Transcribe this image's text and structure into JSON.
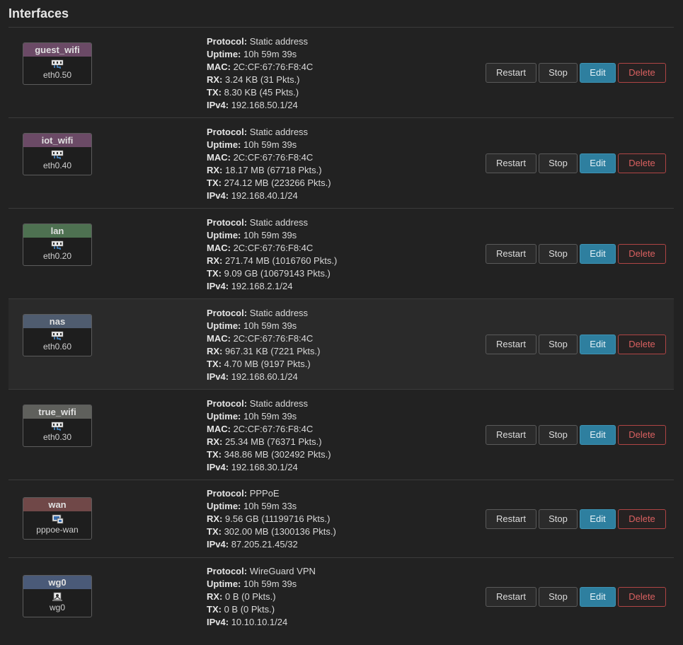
{
  "page": {
    "title": "Interfaces"
  },
  "labels": {
    "protocol": "Protocol:",
    "uptime": "Uptime:",
    "mac": "MAC:",
    "rx": "RX:",
    "tx": "TX:",
    "ipv4": "IPv4:"
  },
  "buttons": {
    "restart": "Restart",
    "stop": "Stop",
    "edit": "Edit",
    "delete": "Delete"
  },
  "colors": {
    "guest_wifi": "#6b4a66",
    "iot_wifi": "#6b4a66",
    "lan": "#4e7151",
    "nas": "#4f5c6f",
    "true_wifi": "#5f605c",
    "wan": "#704848",
    "wg0": "#4a5a78",
    "edit_button": "#2e7f9f",
    "delete_border": "#b04545"
  },
  "interfaces": [
    {
      "name": "guest_wifi",
      "device": "eth0.50",
      "icon": "ethernet-switch-icon",
      "protocol": "Static address",
      "uptime": "10h 59m 39s",
      "mac": "2C:CF:67:76:F8:4C",
      "rx": "3.24 KB (31 Pkts.)",
      "tx": "8.30 KB (45 Pkts.)",
      "ipv4": "192.168.50.1/24"
    },
    {
      "name": "iot_wifi",
      "device": "eth0.40",
      "icon": "ethernet-switch-icon",
      "protocol": "Static address",
      "uptime": "10h 59m 39s",
      "mac": "2C:CF:67:76:F8:4C",
      "rx": "18.17 MB (67718 Pkts.)",
      "tx": "274.12 MB (223266 Pkts.)",
      "ipv4": "192.168.40.1/24"
    },
    {
      "name": "lan",
      "device": "eth0.20",
      "icon": "ethernet-switch-icon",
      "protocol": "Static address",
      "uptime": "10h 59m 39s",
      "mac": "2C:CF:67:76:F8:4C",
      "rx": "271.74 MB (1016760 Pkts.)",
      "tx": "9.09 GB (10679143 Pkts.)",
      "ipv4": "192.168.2.1/24"
    },
    {
      "name": "nas",
      "device": "eth0.60",
      "icon": "ethernet-switch-icon",
      "protocol": "Static address",
      "uptime": "10h 59m 39s",
      "mac": "2C:CF:67:76:F8:4C",
      "rx": "967.31 KB (7221 Pkts.)",
      "tx": "4.70 MB (9197 Pkts.)",
      "ipv4": "192.168.60.1/24"
    },
    {
      "name": "true_wifi",
      "device": "eth0.30",
      "icon": "ethernet-switch-icon",
      "protocol": "Static address",
      "uptime": "10h 59m 39s",
      "mac": "2C:CF:67:76:F8:4C",
      "rx": "25.34 MB (76371 Pkts.)",
      "tx": "348.86 MB (302492 Pkts.)",
      "ipv4": "192.168.30.1/24"
    },
    {
      "name": "wan",
      "device": "pppoe-wan",
      "icon": "network-computer-icon",
      "protocol": "PPPoE",
      "uptime": "10h 59m 33s",
      "rx": "9.56 GB (11199716 Pkts.)",
      "tx": "302.00 MB (1300136 Pkts.)",
      "ipv4": "87.205.21.45/32"
    },
    {
      "name": "wg0",
      "device": "wg0",
      "icon": "tunnel-icon",
      "protocol": "WireGuard VPN",
      "uptime": "10h 59m 39s",
      "rx": "0 B (0 Pkts.)",
      "tx": "0 B (0 Pkts.)",
      "ipv4": "10.10.10.1/24"
    }
  ]
}
